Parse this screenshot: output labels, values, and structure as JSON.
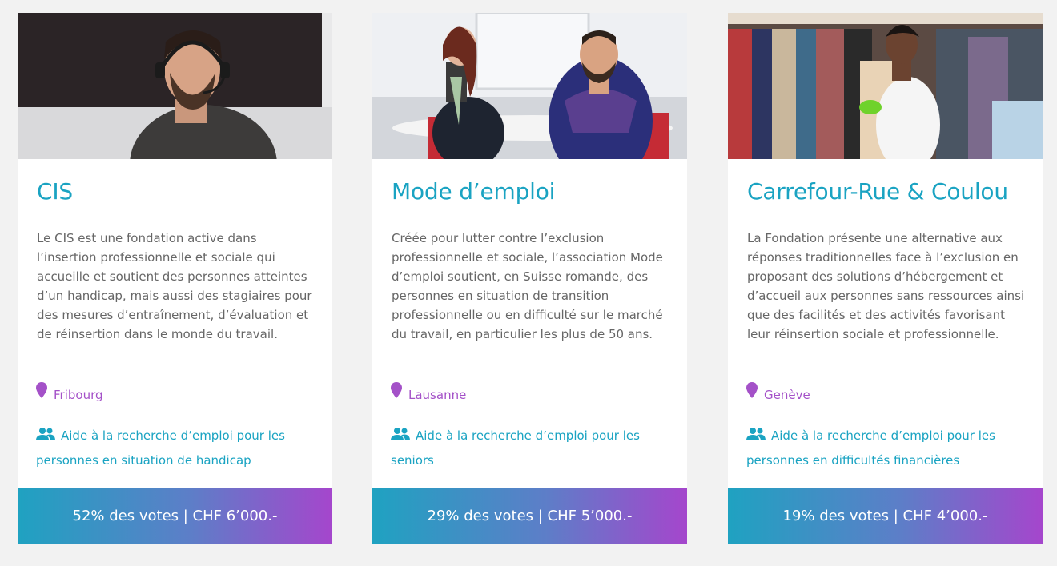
{
  "cards": [
    {
      "title": "CIS",
      "description": "Le CIS est une fondation active dans l’insertion professionnelle et sociale qui accueille et soutient des personnes atteintes d’un handicap, mais aussi des stagiaires pour des mesures d’entraînement, d’évaluation et de réinsertion dans le monde du travail.",
      "location": "Fribourg",
      "aim": "Aide à la recherche d’emploi pour les personnes en situation de handicap",
      "votes": "52% des votes | CHF 6’000.-"
    },
    {
      "title": "Mode d’emploi",
      "description": "Créée pour lutter contre l’exclusion professionnelle et sociale, l’association Mode d’emploi soutient, en Suisse romande, des personnes en situation de transition professionnelle ou en difficulté sur le marché du travail, en particulier les plus de 50 ans.",
      "location": "Lausanne",
      "aim": "Aide à la recherche d’emploi pour les seniors",
      "votes": "29% des votes | CHF 5’000.-"
    },
    {
      "title": "Carrefour-Rue & Coulou",
      "description": "La Fondation présente une alternative aux réponses traditionnelles face à l’exclusion en proposant des solutions d’hébergement et d’accueil aux personnes sans ressources ainsi que des facilités et des activités favorisant leur réinsertion sociale et professionnelle.",
      "location": "Genève",
      "aim": "Aide à la recherche d’emploi pour les personnes en difficultés financières",
      "votes": "19% des votes | CHF 4’000.-"
    }
  ],
  "icons": {
    "location": "map-pin-icon",
    "target_group": "users-icon"
  },
  "colors": {
    "background": "#f2f2f2",
    "title": "#1aa3c2",
    "location": "#a451c8",
    "aim": "#1aa3c2",
    "footer_gradient_start": "#1fa2c1",
    "footer_gradient_end": "#a546cc"
  }
}
